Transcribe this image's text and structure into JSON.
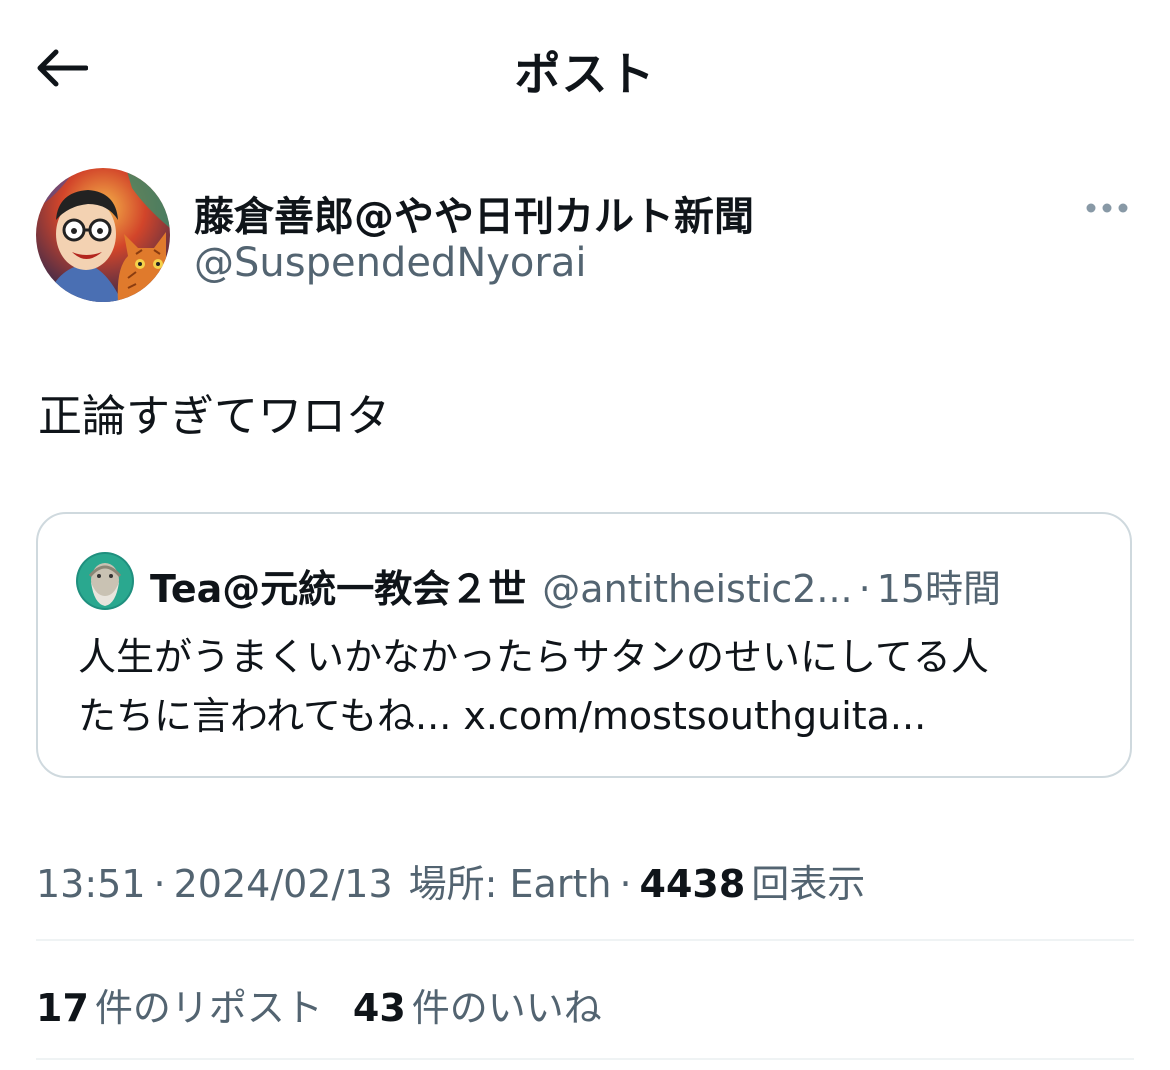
{
  "header": {
    "title": "ポスト",
    "back_icon": "arrow-left-icon"
  },
  "author": {
    "display_name": "藤倉善郎@やや日刊カルト新聞",
    "handle": "@SuspendedNyorai",
    "more_icon": "more-horizontal-icon"
  },
  "tweet": {
    "text": "正論すぎてワロタ"
  },
  "quote": {
    "name": "Tea@元統一教会２世",
    "handle": "@antitheistic2...",
    "separator": "·",
    "time": "15時間",
    "body_line1": "人生がうまくいかなかったらサタンのせいにしてる人",
    "body_line2": "たちに言われてもね... x.com/mostsouthguita..."
  },
  "meta": {
    "time": "13:51",
    "sep1": "·",
    "date": "2024/02/13",
    "location_label": "場所: Earth",
    "sep2": "·",
    "views_count": "4438",
    "views_label": "回表示"
  },
  "stats": {
    "reposts_count": "17",
    "reposts_label": "件のリポスト",
    "likes_count": "43",
    "likes_label": "件のいいね"
  },
  "colors": {
    "primary_text": "#0f1419",
    "secondary_text": "#536471",
    "border": "#cfd9de",
    "divider": "#eff3f4"
  }
}
